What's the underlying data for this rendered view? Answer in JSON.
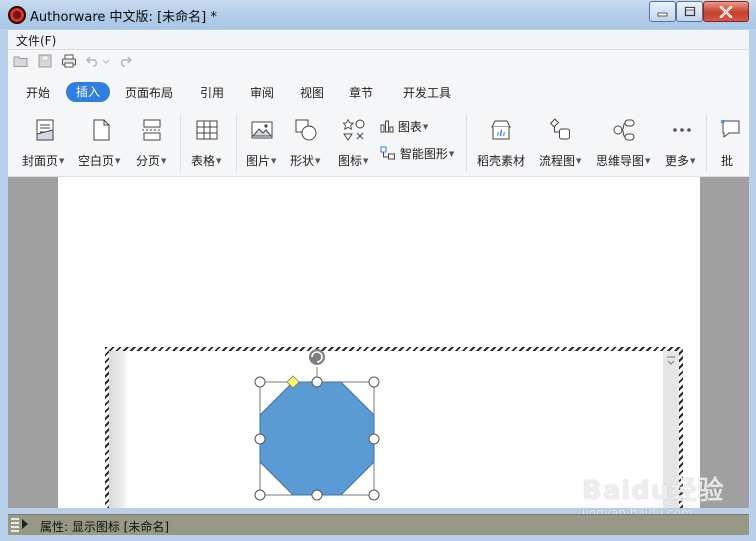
{
  "window": {
    "title": "Authorware 中文版: [未命名] *"
  },
  "menu": {
    "file": "文件(F)"
  },
  "tabs": [
    {
      "label": "开始"
    },
    {
      "label": "插入",
      "active": true
    },
    {
      "label": "页面布局"
    },
    {
      "label": "引用"
    },
    {
      "label": "审阅"
    },
    {
      "label": "视图"
    },
    {
      "label": "章节"
    },
    {
      "label": "开发工具"
    }
  ],
  "ribbon": {
    "cover_page": "封面页",
    "blank_page": "空白页",
    "page_break": "分页",
    "table": "表格",
    "picture": "图片",
    "shape": "形状",
    "icon": "图标",
    "chart": "图表",
    "smart_art": "智能图形",
    "docer_material": "稻壳素材",
    "flowchart": "流程图",
    "mind_map": "思维导图",
    "more": "更多",
    "comment": "批"
  },
  "status": {
    "text": "属性: 显示图标 [未命名]"
  },
  "watermark": {
    "logo": "Baidu经验",
    "url": "jingyan.baidu.com"
  },
  "colors": {
    "accent_tab": "#2f7fe0",
    "shape_fill": "#5b9bd5",
    "shape_stroke": "#41719c",
    "rotate_handle": "#7f7f7f",
    "adjust_handle": "#ffff66"
  }
}
